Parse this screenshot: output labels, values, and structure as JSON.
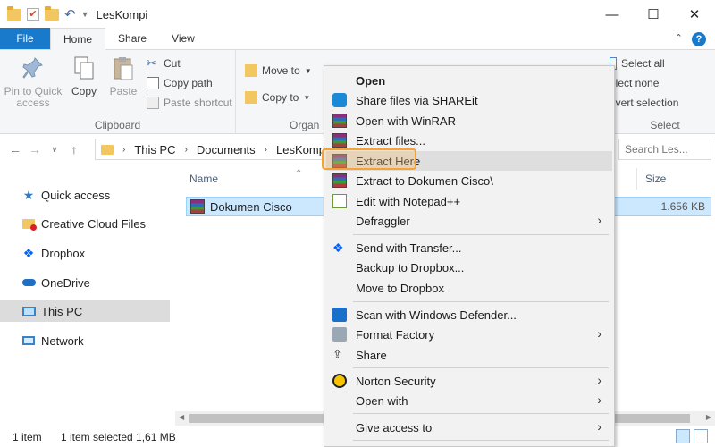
{
  "window": {
    "title": "LesKompi"
  },
  "tabs": [
    "File",
    "Home",
    "Share",
    "View"
  ],
  "ribbon": {
    "clipboard": {
      "label": "Clipboard",
      "pin": "Pin to Quick access",
      "copy": "Copy",
      "paste": "Paste",
      "cut": "Cut",
      "copy_path": "Copy path",
      "paste_shortcut": "Paste shortcut"
    },
    "organize": {
      "label": "Organ",
      "move_to": "Move to",
      "copy_to": "Copy to"
    },
    "open": {
      "open": "Open"
    },
    "select": {
      "label": "Select",
      "all": "Select all",
      "none": "elect none",
      "invert": "nvert selection"
    }
  },
  "address": {
    "crumbs": [
      "This PC",
      "Documents",
      "LesKompi"
    ],
    "search_placeholder": "Search Les..."
  },
  "nav": {
    "items": [
      {
        "label": "Quick access",
        "icon": "star-icon"
      },
      {
        "label": "Creative Cloud Files",
        "icon": "creative-cloud-icon"
      },
      {
        "label": "Dropbox",
        "icon": "dropbox-icon"
      },
      {
        "label": "OneDrive",
        "icon": "onedrive-icon"
      },
      {
        "label": "This PC",
        "icon": "computer-icon"
      },
      {
        "label": "Network",
        "icon": "network-icon"
      }
    ]
  },
  "filelist": {
    "columns": {
      "name": "Name",
      "size": "Size"
    },
    "rows": [
      {
        "name": "Dokumen Cisco",
        "size": "1.656 KB"
      }
    ]
  },
  "status": {
    "count": "1 item",
    "selected": "1 item selected  1,61 MB"
  },
  "context_menu": {
    "items": [
      {
        "label": "Open"
      },
      {
        "label": "Share files via SHAREit"
      },
      {
        "label": "Open with WinRAR"
      },
      {
        "label": "Extract files..."
      },
      {
        "label": "Extract Here"
      },
      {
        "label": "Extract to Dokumen Cisco\\"
      },
      {
        "label": "Edit with Notepad++"
      },
      {
        "label": "Defraggler"
      },
      {
        "label": "Send with Transfer..."
      },
      {
        "label": "Backup to Dropbox..."
      },
      {
        "label": "Move to Dropbox"
      },
      {
        "label": "Scan with Windows Defender..."
      },
      {
        "label": "Format Factory"
      },
      {
        "label": "Share"
      },
      {
        "label": "Norton Security"
      },
      {
        "label": "Open with"
      },
      {
        "label": "Give access to"
      }
    ]
  },
  "colors": {
    "accent": "#1979ca",
    "highlight": "#f3a338",
    "selection": "#cce8ff"
  }
}
